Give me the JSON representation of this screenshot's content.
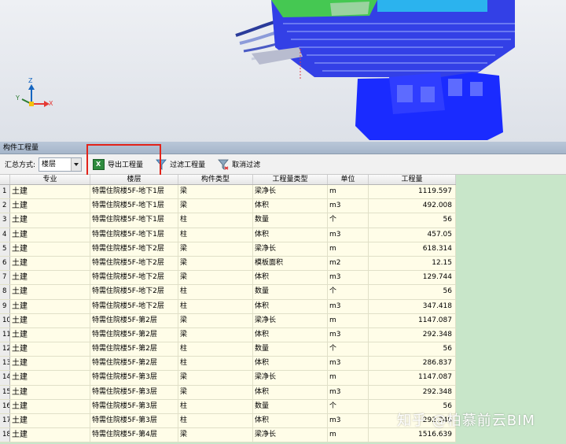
{
  "viewport": {
    "axes": {
      "x": "X",
      "y": "Y",
      "z": "Z"
    },
    "colors": {
      "background": "#e6e9ee",
      "building_blue": "#1a2bff",
      "building_green": "#3fbf4a",
      "axis_x": "#e53935",
      "axis_y": "#2e7d32",
      "axis_z": "#1565c0"
    }
  },
  "panel": {
    "title": "构件工程量"
  },
  "toolbar": {
    "summary_label": "汇总方式:",
    "summary_value": "楼层",
    "export_label": "导出工程量",
    "filter_label": "过滤工程量",
    "cancel_filter_label": "取消过滤"
  },
  "grid": {
    "headers": [
      "专业",
      "楼层",
      "构件类型",
      "工程量类型",
      "单位",
      "工程量"
    ],
    "rows": [
      {
        "num": "1",
        "spec": "土建",
        "floor": "特需住院楼5F-地下1层",
        "type": "梁",
        "qtype": "梁净长",
        "unit": "m",
        "qty": "1119.597"
      },
      {
        "num": "2",
        "spec": "土建",
        "floor": "特需住院楼5F-地下1层",
        "type": "梁",
        "qtype": "体积",
        "unit": "m3",
        "qty": "492.008"
      },
      {
        "num": "3",
        "spec": "土建",
        "floor": "特需住院楼5F-地下1层",
        "type": "柱",
        "qtype": "数量",
        "unit": "个",
        "qty": "56"
      },
      {
        "num": "4",
        "spec": "土建",
        "floor": "特需住院楼5F-地下1层",
        "type": "柱",
        "qtype": "体积",
        "unit": "m3",
        "qty": "457.05"
      },
      {
        "num": "5",
        "spec": "土建",
        "floor": "特需住院楼5F-地下2层",
        "type": "梁",
        "qtype": "梁净长",
        "unit": "m",
        "qty": "618.314"
      },
      {
        "num": "6",
        "spec": "土建",
        "floor": "特需住院楼5F-地下2层",
        "type": "梁",
        "qtype": "模板面积",
        "unit": "m2",
        "qty": "12.15"
      },
      {
        "num": "7",
        "spec": "土建",
        "floor": "特需住院楼5F-地下2层",
        "type": "梁",
        "qtype": "体积",
        "unit": "m3",
        "qty": "129.744"
      },
      {
        "num": "8",
        "spec": "土建",
        "floor": "特需住院楼5F-地下2层",
        "type": "柱",
        "qtype": "数量",
        "unit": "个",
        "qty": "56"
      },
      {
        "num": "9",
        "spec": "土建",
        "floor": "特需住院楼5F-地下2层",
        "type": "柱",
        "qtype": "体积",
        "unit": "m3",
        "qty": "347.418"
      },
      {
        "num": "10",
        "spec": "土建",
        "floor": "特需住院楼5F-第2层",
        "type": "梁",
        "qtype": "梁净长",
        "unit": "m",
        "qty": "1147.087"
      },
      {
        "num": "11",
        "spec": "土建",
        "floor": "特需住院楼5F-第2层",
        "type": "梁",
        "qtype": "体积",
        "unit": "m3",
        "qty": "292.348"
      },
      {
        "num": "12",
        "spec": "土建",
        "floor": "特需住院楼5F-第2层",
        "type": "柱",
        "qtype": "数量",
        "unit": "个",
        "qty": "56"
      },
      {
        "num": "13",
        "spec": "土建",
        "floor": "特需住院楼5F-第2层",
        "type": "柱",
        "qtype": "体积",
        "unit": "m3",
        "qty": "286.837"
      },
      {
        "num": "14",
        "spec": "土建",
        "floor": "特需住院楼5F-第3层",
        "type": "梁",
        "qtype": "梁净长",
        "unit": "m",
        "qty": "1147.087"
      },
      {
        "num": "15",
        "spec": "土建",
        "floor": "特需住院楼5F-第3层",
        "type": "梁",
        "qtype": "体积",
        "unit": "m3",
        "qty": "292.348"
      },
      {
        "num": "16",
        "spec": "土建",
        "floor": "特需住院楼5F-第3层",
        "type": "柱",
        "qtype": "数量",
        "unit": "个",
        "qty": "56"
      },
      {
        "num": "17",
        "spec": "土建",
        "floor": "特需住院楼5F-第3层",
        "type": "柱",
        "qtype": "体积",
        "unit": "m3",
        "qty": "292.348"
      },
      {
        "num": "18",
        "spec": "土建",
        "floor": "特需住院楼5F-第4层",
        "type": "梁",
        "qtype": "梁净长",
        "unit": "m",
        "qty": "1516.639"
      }
    ]
  },
  "watermark": "知乎 @柏慕前云BIM"
}
